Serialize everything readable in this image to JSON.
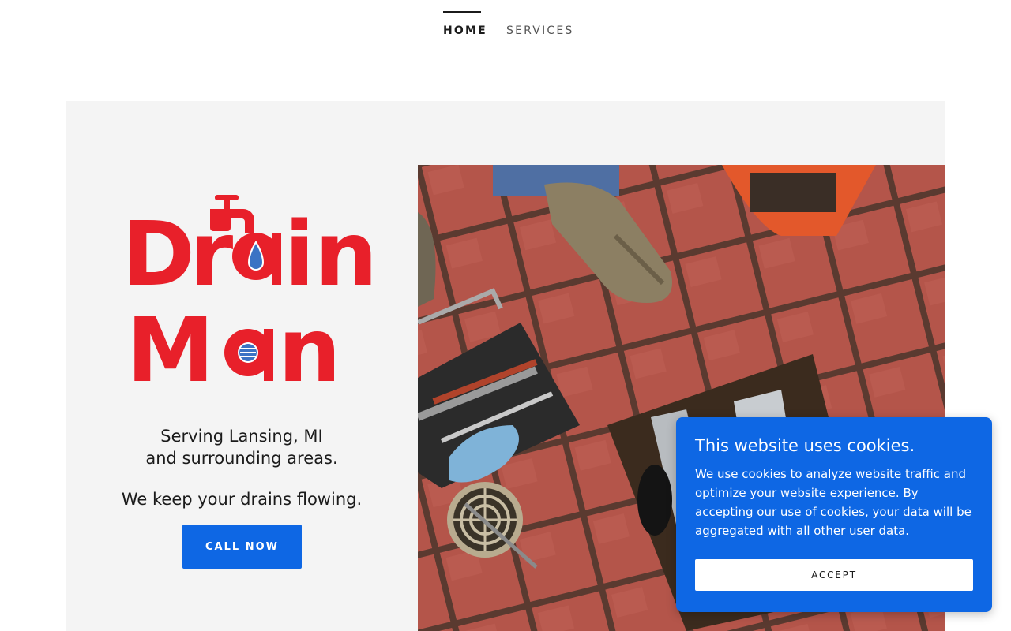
{
  "nav": {
    "items": [
      {
        "label": "HOME",
        "active": true
      },
      {
        "label": "SERVICES",
        "active": false
      }
    ]
  },
  "hero": {
    "logo": {
      "line1": "Drain",
      "line2": "Man",
      "color": "#e8202a",
      "accent": "#3b73c4"
    },
    "tagline_line1": "Serving Lansing, MI",
    "tagline_line2": "and surrounding areas.",
    "motto": "We keep your drains flowing.",
    "cta_label": "CALL NOW"
  },
  "cookie_banner": {
    "title": "This website uses cookies.",
    "text": "We use cookies to analyze website traffic and optimize your website experience. By accepting our use of cookies, your data will be aggregated with all other user data.",
    "accept_label": "ACCEPT"
  },
  "colors": {
    "accent": "#0e67e4",
    "hero_bg": "#f4f4f4",
    "brand_red": "#e8202a"
  }
}
